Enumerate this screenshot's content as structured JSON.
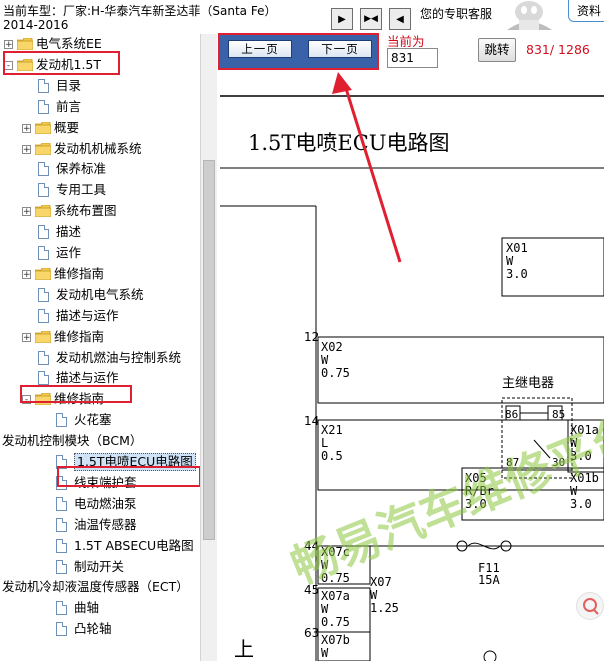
{
  "header": {
    "vehicle_info": "当前车型：厂家:H-华泰汽车新圣达菲（Santa Fe）2014-2016",
    "vip_label": "您的专职客服",
    "resource_label": "资料",
    "nav_buttons": [
      "first-page",
      "prev-next",
      "last-page"
    ]
  },
  "tree": {
    "items": [
      {
        "label": "电气系统EE",
        "level": 0,
        "type": "folder",
        "expand": "+"
      },
      {
        "label": "发动机1.5T",
        "level": 0,
        "type": "folder",
        "expand": "-"
      },
      {
        "label": "目录",
        "level": 1,
        "type": "doc"
      },
      {
        "label": "前言",
        "level": 1,
        "type": "doc"
      },
      {
        "label": "概要",
        "level": 1,
        "type": "folder",
        "expand": "+"
      },
      {
        "label": "发动机机械系统",
        "level": 1,
        "type": "folder",
        "expand": "+"
      },
      {
        "label": "保养标准",
        "level": 1,
        "type": "doc"
      },
      {
        "label": "专用工具",
        "level": 1,
        "type": "doc"
      },
      {
        "label": "系统布置图",
        "level": 1,
        "type": "folder",
        "expand": "+"
      },
      {
        "label": "描述",
        "level": 1,
        "type": "doc"
      },
      {
        "label": "运作",
        "level": 1,
        "type": "doc"
      },
      {
        "label": "维修指南",
        "level": 1,
        "type": "folder",
        "expand": "+"
      },
      {
        "label": "发动机电气系统",
        "level": 1,
        "type": "doc"
      },
      {
        "label": "描述与运作",
        "level": 1,
        "type": "doc"
      },
      {
        "label": "维修指南",
        "level": 1,
        "type": "folder",
        "expand": "+"
      },
      {
        "label": "发动机燃油与控制系统",
        "level": 1,
        "type": "doc"
      },
      {
        "label": "描述与运作",
        "level": 1,
        "type": "doc"
      },
      {
        "label": "维修指南",
        "level": 1,
        "type": "folder",
        "expand": "-"
      },
      {
        "label": "火花塞",
        "level": 2,
        "type": "doc"
      },
      {
        "label": "发动机控制模块（BCM）",
        "level": -1,
        "type": "none"
      },
      {
        "label": "1.5T电喷ECU电路图",
        "level": 2,
        "type": "doc",
        "selected": true
      },
      {
        "label": "线束端护套",
        "level": 2,
        "type": "doc"
      },
      {
        "label": "电动燃油泵",
        "level": 2,
        "type": "doc"
      },
      {
        "label": "油温传感器",
        "level": 2,
        "type": "doc"
      },
      {
        "label": "1.5T ABSECU电路图",
        "level": 2,
        "type": "doc"
      },
      {
        "label": "制动开关",
        "level": 2,
        "type": "doc"
      },
      {
        "label": "发动机冷却液温度传感器（ECT）",
        "level": -1,
        "type": "none"
      },
      {
        "label": "曲轴",
        "level": 2,
        "type": "doc"
      },
      {
        "label": "凸轮轴",
        "level": 2,
        "type": "doc"
      }
    ]
  },
  "toolbar": {
    "prev_page": "上一页",
    "next_page": "下一页",
    "current_label": "当前为",
    "current_page": "831",
    "jump_label": "跳转",
    "page_count": "831/ 1286"
  },
  "document": {
    "title": "1.5T电喷ECU电路图",
    "left_numbers": [
      "12",
      "14",
      "44",
      "45",
      "63"
    ],
    "connectors": [
      {
        "id": "X01",
        "lines": [
          "X01",
          "W",
          "3.0"
        ]
      },
      {
        "id": "X02",
        "lines": [
          "X02",
          "W",
          "0.75"
        ]
      },
      {
        "id": "X21",
        "lines": [
          "X21",
          "L",
          "0.5"
        ]
      },
      {
        "id": "X01a",
        "lines": [
          "X01a",
          "W",
          "3.0"
        ]
      },
      {
        "id": "X05",
        "lines": [
          "X05",
          "R/Br",
          "3.0"
        ]
      },
      {
        "id": "X01b",
        "lines": [
          "X01b",
          "W",
          "3.0"
        ]
      },
      {
        "id": "X07c",
        "lines": [
          "X07c",
          "W",
          "0.75"
        ]
      },
      {
        "id": "X07",
        "lines": [
          "X07",
          "W",
          "1.25"
        ]
      },
      {
        "id": "X07a",
        "lines": [
          "X07a",
          "W",
          "0.75"
        ]
      },
      {
        "id": "X07b",
        "lines": [
          "X07b",
          "W"
        ]
      }
    ],
    "relay_label": "主继电器",
    "relay_pins": [
      "86",
      "85",
      "87",
      "30"
    ],
    "fuse_label": "F11",
    "fuse_rating": "15A",
    "bottom_text": "上",
    "watermark": "畅易汽车维修平台"
  },
  "colors": {
    "accent_red": "#e02030",
    "nav_blue": "#3a62a8",
    "watermark_green": "#8cc63f"
  }
}
